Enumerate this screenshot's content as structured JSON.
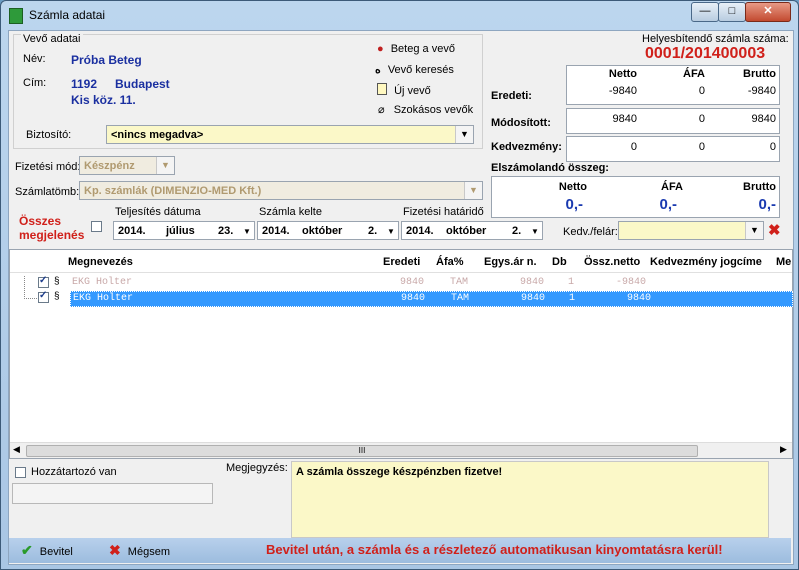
{
  "window": {
    "title": "Számla adatai",
    "min": "—",
    "max": "□",
    "close": "✕"
  },
  "buyer": {
    "group": "Vevő adatai",
    "name_label": "Név:",
    "name": "Próba Beteg",
    "address_label": "Cím:",
    "zip": "1192",
    "city": "Budapest",
    "street": "Kis köz. 11.",
    "actions": [
      "Beteg a vevő",
      "Vevő keresés",
      "Új vevő",
      "Szokásos vevők"
    ],
    "insurer_label": "Biztosító:",
    "insurer": "<nincs megadva>"
  },
  "payment": {
    "label": "Fizetési mód:",
    "value": "Készpénz"
  },
  "invoice_block": {
    "label": "Számlatömb:",
    "value": "Kp. számlák (DIMENZIO-MED Kft.)"
  },
  "all_show": {
    "line1": "Összes",
    "line2": "megjelenés"
  },
  "dates": {
    "perf": {
      "label": "Teljesítés dátuma",
      "y": "2014.",
      "m": "július",
      "d": "23."
    },
    "issue": {
      "label": "Számla kelte",
      "y": "2014.",
      "m": "október",
      "d": "2."
    },
    "due": {
      "label": "Fizetési határidő",
      "y": "2014.",
      "m": "október",
      "d": "2."
    }
  },
  "discount": {
    "label": "Kedv./felár:"
  },
  "correction": {
    "label": "Helyesbítendő számla száma:",
    "number": "0001/201400003"
  },
  "totals": {
    "headers": [
      "Netto",
      "ÁFA",
      "Brutto"
    ],
    "rows": [
      {
        "label": "Eredeti:",
        "values": [
          "-9840",
          "0",
          "-9840"
        ]
      },
      {
        "label": "Módosított:",
        "values": [
          "9840",
          "0",
          "9840"
        ]
      },
      {
        "label": "Kedvezmény:",
        "values": [
          "0",
          "0",
          "0"
        ]
      }
    ],
    "settle_label": "Elszámolandó összeg:",
    "settle_values": [
      "0,-",
      "0,-",
      "0,-"
    ]
  },
  "table": {
    "headers": [
      "Megnevezés",
      "Eredeti",
      "Áfa%",
      "Egys.ár n.",
      "Db",
      "Össz.netto",
      "Kedvezmény jogcíme",
      "Me"
    ],
    "rows": [
      {
        "name": "EKG Holter",
        "orig": "9840",
        "vat": "TAM",
        "unit": "9840",
        "qty": "1",
        "net": "-9840"
      },
      {
        "name": "EKG Holter",
        "orig": "9840",
        "vat": "TAM",
        "unit": "9840",
        "qty": "1",
        "net": "9840"
      }
    ],
    "scroll_thumb": "III"
  },
  "bottom": {
    "attach_label": "Hozzátartozó van",
    "note_label": "Megjegyzés:",
    "note": "A számla összege készpénzben fizetve!",
    "ok": "Bevitel",
    "cancel": "Mégsem",
    "info": "Bevitel után, a számla és a részletező automatikusan kinyomtatásra kerül!"
  }
}
